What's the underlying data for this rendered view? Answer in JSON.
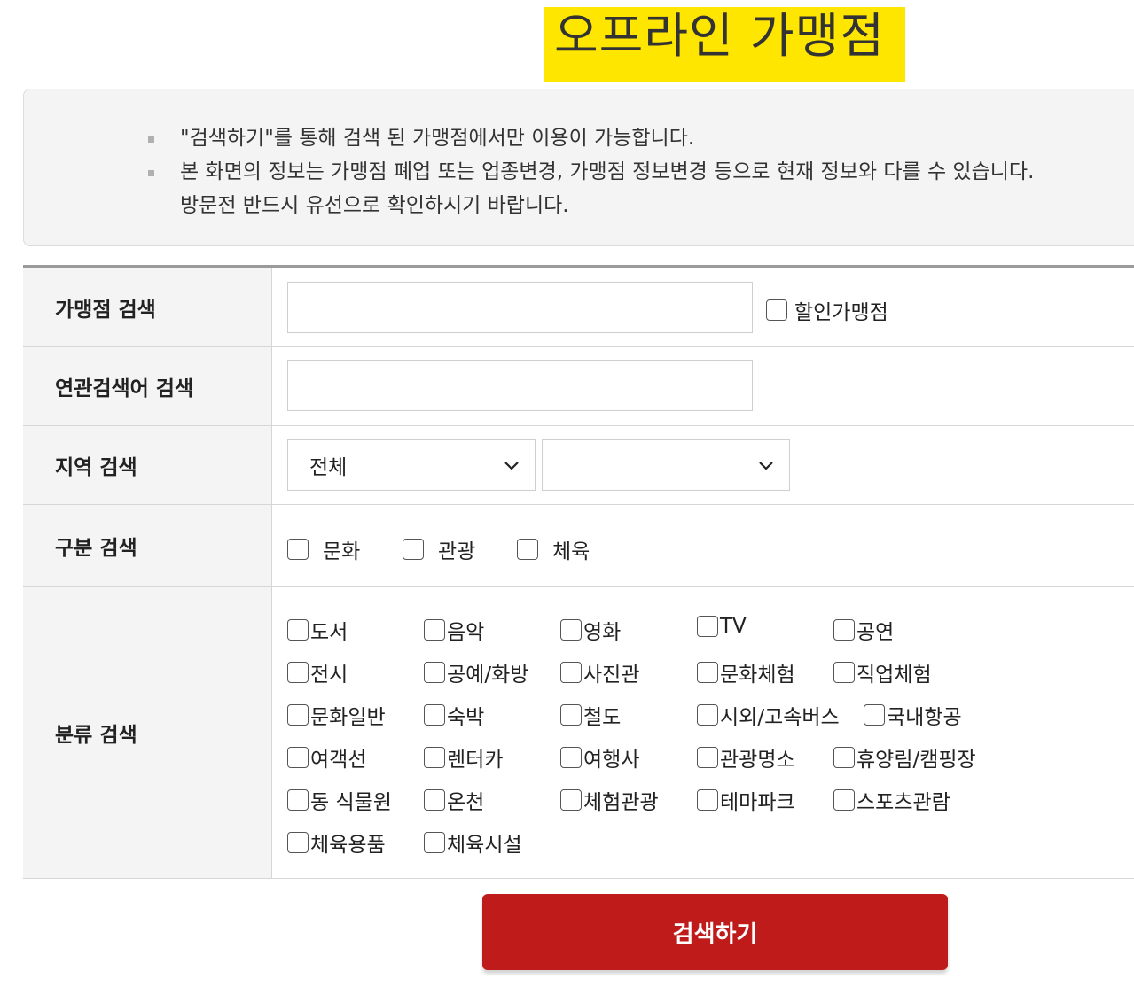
{
  "page": {
    "title": "오프라인 가맹점"
  },
  "notice": {
    "items": [
      {
        "line1": "\"검색하기\"를 통해 검색 된 가맹점에서만 이용이 가능합니다.",
        "line2": ""
      },
      {
        "line1": "본 화면의 정보는 가맹점 폐업 또는 업종변경, 가맹점 정보변경 등으로 현재 정보와 다를 수 있습니다.",
        "line2": "방문전 반드시 유선으로 확인하시기 바랍니다."
      }
    ]
  },
  "form": {
    "store": {
      "label": "가맹점 검색",
      "value": "",
      "discount_label": "할인가맹점"
    },
    "keyword": {
      "label": "연관검색어 검색",
      "value": ""
    },
    "region": {
      "label": "지역 검색",
      "select1": "전체",
      "select2": ""
    },
    "division": {
      "label": "구분 검색",
      "options": [
        "문화",
        "관광",
        "체육"
      ]
    },
    "category": {
      "label": "분류 검색",
      "rows": [
        [
          "도서",
          "음악",
          "영화",
          "TV",
          "공연"
        ],
        [
          "전시",
          "공예/화방",
          "사진관",
          "문화체험",
          "직업체험"
        ],
        [
          "문화일반",
          "숙박",
          "철도",
          "시외/고속버스",
          "국내항공"
        ],
        [
          "여객선",
          "렌터카",
          "여행사",
          "관광명소",
          "휴양림/캠핑장"
        ],
        [
          "동 식물원",
          "온천",
          "체험관광",
          "테마파크",
          "스포츠관람"
        ],
        [
          "체육용품",
          "체육시설"
        ]
      ]
    }
  },
  "search_button": {
    "label": "검색하기"
  },
  "colors": {
    "highlight": "#ffe600",
    "button": "#c01b1b"
  }
}
